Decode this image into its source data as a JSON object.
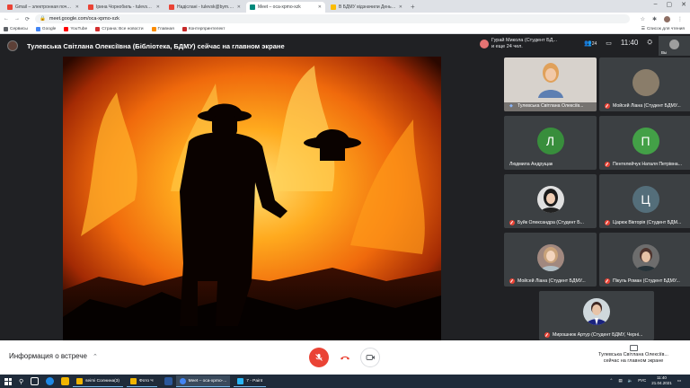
{
  "browser": {
    "tabs": [
      {
        "label": "Gmail – электронная почта от",
        "color": "#ea4335"
      },
      {
        "label": "Ірина Чорнобиль - tulevska@",
        "color": "#ea4335"
      },
      {
        "label": "Надіслані - tulevsk@bym.edu",
        "color": "#ea4335"
      },
      {
        "label": "Meet – oca-xpmo-xzk",
        "color": "#00897b",
        "active": true
      },
      {
        "label": "В БДМУ відзначили День зорі",
        "color": "#fbbc04"
      }
    ],
    "url": "meet.google.com/oca-xpmo-xzk",
    "bookmarks": [
      {
        "label": "Сервисы",
        "color": "#5f6368"
      },
      {
        "label": "Google",
        "color": "#4285f4"
      },
      {
        "label": "YouTube",
        "color": "#ff0000"
      },
      {
        "label": "Страна: Все новости",
        "color": "#d32f2f"
      },
      {
        "label": "Главная",
        "color": "#fb8c00"
      },
      {
        "label": "Контерпринтелект",
        "color": "#c62828"
      }
    ],
    "reading_list": "Список для чтения"
  },
  "meeting": {
    "presenting_title": "Тулевська Світлана Олексіївна (Бібліотека, БДМУ) сейчас на главном экране",
    "notification_line1": "Гурай Микола (Студент БД...",
    "notification_line2": "и еще 24 чел.",
    "participant_count": "24",
    "time": "11:40",
    "self_label": "Вы",
    "participants": [
      {
        "name": "Тулевська Світлана Олексіїв...",
        "type": "self",
        "muted": false
      },
      {
        "name": "Мойсей Ліана (Студент БДМУ...",
        "type": "photo",
        "bg": "#8a7d6a",
        "muted": true
      },
      {
        "name": "Людмила Андрущак",
        "type": "letter",
        "letter": "Л",
        "bg": "#388e3c",
        "muted": false
      },
      {
        "name": "Пентелейчук Наталя Петрівна...",
        "type": "letter",
        "letter": "П",
        "bg": "#43a047",
        "muted": true
      },
      {
        "name": "Буйк Олександра (Студент Б...",
        "type": "photo",
        "bg": "#e0e0e0",
        "muted": true
      },
      {
        "name": "Царюк Вікторія (Студент БДМ...",
        "type": "letter",
        "letter": "Ц",
        "bg": "#546e7a",
        "muted": true
      },
      {
        "name": "Мойсей Ліана (Студент БДМУ...",
        "type": "photo",
        "bg": "#a1887f",
        "muted": true
      },
      {
        "name": "Пікуль Роман (Студент БДМУ...",
        "type": "photo",
        "bg": "#6d6d6d",
        "muted": true
      },
      {
        "name": "Мирошнюк Артур (Студент БДМУ, Черні...",
        "type": "photo",
        "bg": "#cfd8dc",
        "muted": true
      }
    ],
    "info_label": "Информация о встрече",
    "presenter_status_line1": "Тулевська Світлана Олексіїв...",
    "presenter_status_line2": "сейчас на главном экране"
  },
  "taskbar": {
    "apps": [
      {
        "label": "seimi Солнина(3)",
        "color": "#f0b400"
      },
      {
        "label": "Фото Ч",
        "color": "#f0b400"
      },
      {
        "label": "Meet – oca-xpmo-...",
        "color": "#4285f4",
        "active": true
      },
      {
        "label": "7 - Paint",
        "color": "#29b6f6"
      }
    ],
    "lang": "РУС",
    "clock_time": "11:40",
    "clock_date": "21.04.2021"
  },
  "colors": {
    "meet_dark": "#202124",
    "mic_off_red": "#ea4335",
    "hangup_red": "#ea4335"
  }
}
